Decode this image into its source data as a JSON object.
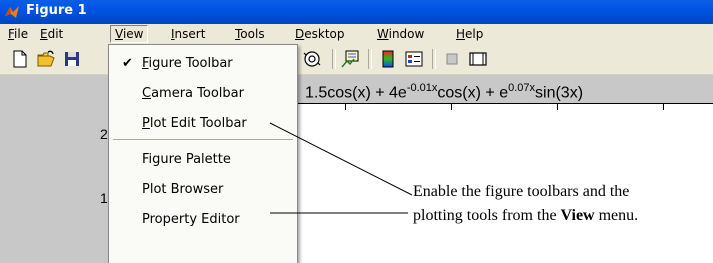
{
  "window": {
    "title": "Figure 1",
    "icon": "matlab-icon"
  },
  "menubar": {
    "items": [
      {
        "label": "File",
        "underline": "F",
        "rest": "ile"
      },
      {
        "label": "Edit",
        "underline": "E",
        "rest": "dit"
      },
      {
        "label": "View",
        "underline": "V",
        "rest": "iew"
      },
      {
        "label": "Insert",
        "underline": "I",
        "rest": "nsert"
      },
      {
        "label": "Tools",
        "underline": "T",
        "rest": "ools"
      },
      {
        "label": "Desktop",
        "underline": "D",
        "rest": "esktop"
      },
      {
        "label": "Window",
        "underline": "W",
        "rest": "indow"
      },
      {
        "label": "Help",
        "underline": "H",
        "rest": "elp"
      }
    ]
  },
  "toolbar": {
    "icons": [
      "new-file-icon",
      "open-folder-icon",
      "save-icon",
      "rotate-3d-icon",
      "pan-hand-icon",
      "data-cursor-icon",
      "insert-legend-icon",
      "insert-colorbar-icon",
      "hide-plot-tools-icon",
      "show-plot-tools-icon"
    ]
  },
  "view_menu": {
    "items": [
      {
        "label": "Figure Toolbar",
        "underline": "F",
        "rest": "igure Toolbar",
        "checked": true,
        "check": "✔"
      },
      {
        "label": "Camera Toolbar",
        "underline": "C",
        "rest": "amera Toolbar",
        "checked": false
      },
      {
        "label": "Plot Edit Toolbar",
        "underline": "P",
        "rest": "lot Edit Toolbar",
        "checked": false
      },
      {
        "label": "Figure Palette",
        "checked": false
      },
      {
        "label": "Plot Browser",
        "checked": false
      },
      {
        "label": "Property Editor",
        "checked": false
      }
    ]
  },
  "plot": {
    "title_parts": [
      "1.5cos(x) + 4e",
      "-0.01x",
      "cos(x) + e",
      "0.07x",
      "sin(3x)"
    ],
    "yticks": [
      "2",
      "1"
    ]
  },
  "annotation": {
    "line1": "Enable the figure toolbars and the",
    "line2_pre": "plotting tools from the ",
    "line2_bold": "View",
    "line2_post": " menu."
  },
  "colors": {
    "titlebar": "#0054e3",
    "chrome": "#ece9d8",
    "figure_bg": "#c8c8c8"
  }
}
